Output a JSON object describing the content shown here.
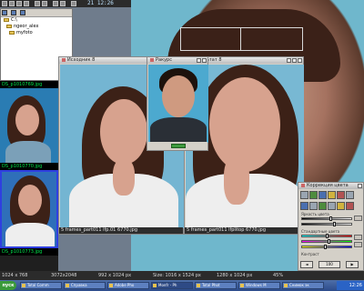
{
  "topbar": {
    "clock": "21 12:26"
  },
  "tree": {
    "items": [
      {
        "label": "C:\\"
      },
      {
        "label": "ngeor_alex"
      },
      {
        "label": "myfoto"
      }
    ]
  },
  "thumbs": [
    {
      "label": "DS_p1010769.jpg"
    },
    {
      "label": "DS_p1010770.jpg"
    },
    {
      "label": "DS_p1010773.jpg"
    }
  ],
  "windows": {
    "left": {
      "title": "Исходник  8",
      "status": "5 frames_part011 lfp.01 6770.jpg"
    },
    "right": {
      "title": "Результат  8",
      "status": "5 frames_part011 lfplitop 6770.jpg"
    },
    "popup": {
      "title": "Ракурс"
    }
  },
  "panel": {
    "title": "Коррекция цвета",
    "label_brightness": "Яркость цвета",
    "label_balance": "Стандартные цвета",
    "label_contrast": "Контраст",
    "foot_left": "◄",
    "foot_mid": "100",
    "foot_right": "▶"
  },
  "statusbar": {
    "size1": "1024 x 768",
    "size2": "3072x2048",
    "zoom": "45%",
    "info1": "992 x 1024 px",
    "info2": "Size: 1016 x 1524 px",
    "info3": "1280 x 1024 px"
  },
  "taskbar": {
    "start": "пуск",
    "tasks": [
      "Total Comm",
      "Справка",
      "Adobe Pho",
      "Monfr - Ph",
      "Total Phot",
      "Windows M",
      "Снимок эк"
    ],
    "clock": "12:26"
  },
  "colors": {
    "thumb_label": "#00e84c",
    "selected_border": "#2f3fe0",
    "taskbar": "#2c4b8b"
  }
}
